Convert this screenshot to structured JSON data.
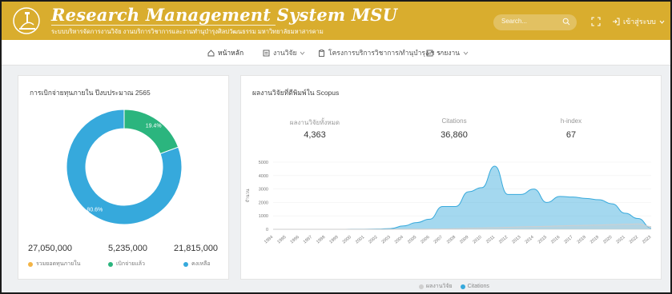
{
  "header": {
    "title": "Research Management System MSU",
    "subtitle": "ระบบบริหารจัดการงานวิจัย งานบริการวิชาการและงานทำนุบำรุงศิลปวัฒนธรรม มหาวิทยาลัยมหาสารคาม",
    "search_placeholder": "Search...",
    "login_label": "เข้าสู่ระบบ",
    "colors": {
      "bar": "#d9ad2e"
    }
  },
  "nav": {
    "items": [
      {
        "label": "หน้าหลัก",
        "icon": "home-icon"
      },
      {
        "label": "งานวิจัย",
        "icon": "list-icon",
        "dropdown": true
      },
      {
        "label": "โครงการบริการวิชาการ/ทำนุบำรุง ฯ",
        "icon": "clipboard-icon",
        "dropdown": true
      },
      {
        "label": "รายงาน",
        "icon": "report-icon",
        "dropdown": true
      }
    ]
  },
  "budget": {
    "title": "การเบิกจ่ายทุนภายใน ปีงบประมาณ 2565",
    "stats": [
      {
        "value": "27,050,000",
        "label": "รวมยอดทุนภายใน",
        "color": "#f3b446"
      },
      {
        "value": "5,235,000",
        "label": "เบิกจ่ายแล้ว",
        "color": "#2bb57e"
      },
      {
        "value": "21,815,000",
        "label": "คงเหลือ",
        "color": "#36a9dc"
      }
    ]
  },
  "scopus": {
    "title": "ผลงานวิจัยที่ตีพิมพ์ใน Scopus",
    "metrics": [
      {
        "label": "ผลงานวิจัยทั้งหมด",
        "value": "4,363"
      },
      {
        "label": "Citations",
        "value": "36,860"
      },
      {
        "label": "h-index",
        "value": "67"
      }
    ],
    "legend": [
      "ผลงานวิจัย",
      "Citations"
    ]
  },
  "chart_data": [
    {
      "type": "pie",
      "categories": [
        "เบิกจ่ายแล้ว",
        "คงเหลือ"
      ],
      "values": [
        19.4,
        80.6
      ],
      "labels": [
        "19.4%",
        "80.6%"
      ],
      "colors": [
        "#2bb57e",
        "#36a9dc"
      ]
    },
    {
      "type": "area",
      "ylabel": "จำนวน",
      "ylim": [
        0,
        5000
      ],
      "yticks": [
        0,
        1000,
        2000,
        3000,
        4000,
        5000
      ],
      "x": [
        "1994",
        "1995",
        "1996",
        "1997",
        "1998",
        "1999",
        "2000",
        "2001",
        "2002",
        "2003",
        "2004",
        "2005",
        "2006",
        "2007",
        "2008",
        "2009",
        "2010",
        "2011",
        "2012",
        "2013",
        "2014",
        "2015",
        "2016",
        "2017",
        "2018",
        "2019",
        "2020",
        "2021",
        "2022",
        "2023"
      ],
      "series": [
        {
          "name": "Citations",
          "color": "#36a9dc",
          "values": [
            0,
            0,
            0,
            0,
            0,
            0,
            5,
            10,
            20,
            50,
            250,
            500,
            750,
            1700,
            1700,
            2800,
            3100,
            4700,
            2600,
            2600,
            3000,
            2000,
            2450,
            2400,
            2300,
            2200,
            1900,
            1200,
            800,
            100
          ]
        },
        {
          "name": "ผลงานวิจัย",
          "color": "#cfcfcf",
          "values": [
            0,
            0,
            0,
            0,
            0,
            0,
            0,
            0,
            0,
            5,
            10,
            15,
            20,
            30,
            50,
            80,
            100,
            120,
            150,
            180,
            200,
            220,
            250,
            280,
            300,
            320,
            350,
            380,
            400,
            200
          ]
        }
      ]
    }
  ]
}
